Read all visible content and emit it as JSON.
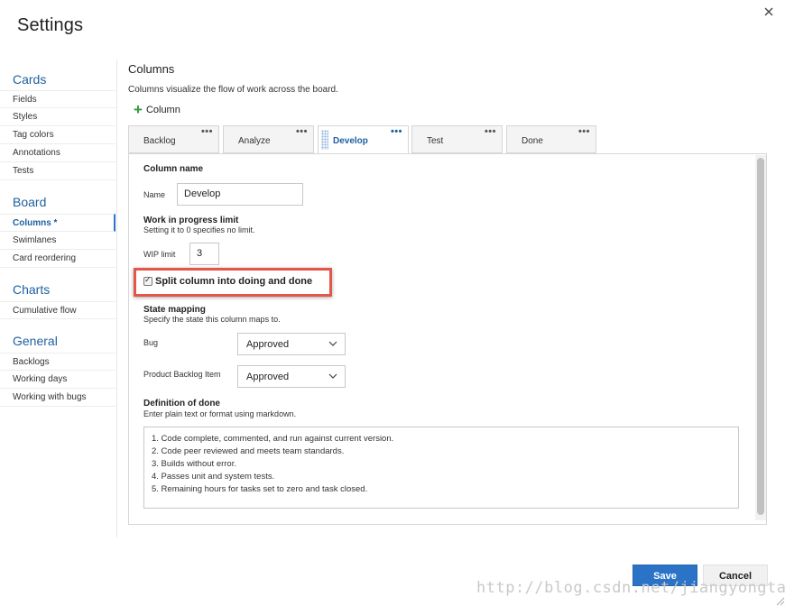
{
  "dialog": {
    "title": "Settings"
  },
  "sidebar": {
    "sections": [
      {
        "heading": "Cards",
        "items": [
          "Fields",
          "Styles",
          "Tag colors",
          "Annotations",
          "Tests"
        ]
      },
      {
        "heading": "Board",
        "items": [
          "Columns *",
          "Swimlanes",
          "Card reordering"
        ]
      },
      {
        "heading": "Charts",
        "items": [
          "Cumulative flow"
        ]
      },
      {
        "heading": "General",
        "items": [
          "Backlogs",
          "Working days",
          "Working with bugs"
        ]
      }
    ],
    "active_item": "Columns *"
  },
  "main": {
    "title": "Columns",
    "description": "Columns visualize the flow of work across the board.",
    "add_column_label": "Column",
    "tabs": [
      {
        "label": "Backlog",
        "more": "•••"
      },
      {
        "label": "Analyze",
        "more": "•••"
      },
      {
        "label": "Develop",
        "more": "•••"
      },
      {
        "label": "Test",
        "more": "•••"
      },
      {
        "label": "Done",
        "more": "•••"
      }
    ],
    "active_tab": "Develop"
  },
  "form": {
    "column_name_heading": "Column name",
    "name_label": "Name",
    "name_value": "Develop",
    "wip_heading": "Work in progress limit",
    "wip_sub": "Setting it to 0 specifies no limit.",
    "wip_label": "WIP limit",
    "wip_value": "3",
    "split_label": "Split column into doing and done",
    "split_checked": true,
    "state_heading": "State mapping",
    "state_sub": "Specify the state this column maps to.",
    "bug_label": "Bug",
    "bug_value": "Approved",
    "pbi_label": "Product Backlog Item",
    "pbi_value": "Approved",
    "dod_heading": "Definition of done",
    "dod_sub": "Enter plain text or format using markdown.",
    "dod_lines": [
      "1. Code complete, commented, and run against current version.",
      "2. Code peer reviewed and meets team standards.",
      "3. Builds without error.",
      "4. Passes unit and system tests.",
      "5. Remaining hours for tasks set to zero and task closed."
    ]
  },
  "footer": {
    "save_label": "Save",
    "cancel_label": "Cancel"
  },
  "watermark": "http://blog.csdn.net/jiangyongtao",
  "colors": {
    "accent": "#2a73c7",
    "highlight": "#e2574a",
    "add_icon": "#2e9c3a"
  }
}
